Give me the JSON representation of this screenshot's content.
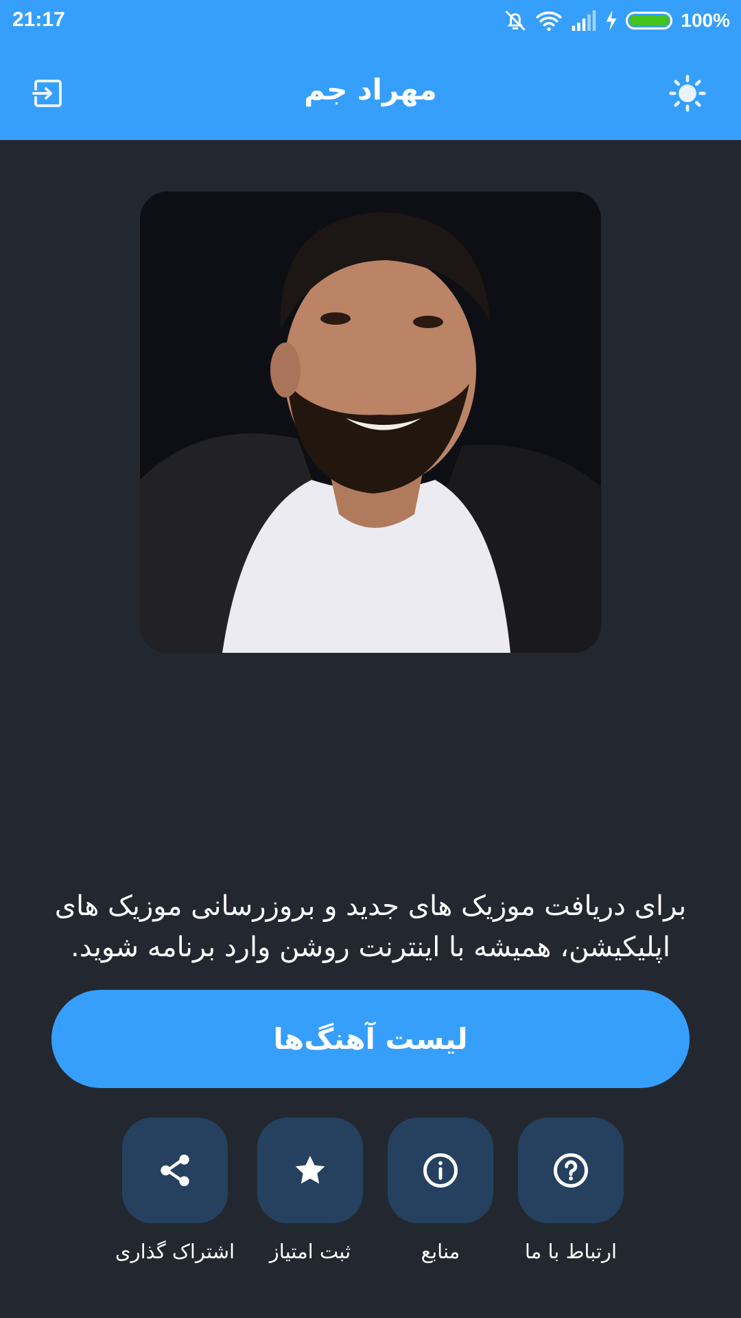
{
  "status_bar": {
    "time": "21:17",
    "battery_percent": "100%",
    "battery_level": 1.0,
    "icons": [
      "muted-bell-icon",
      "wifi-icon",
      "signal-icon",
      "charging-icon",
      "battery-icon"
    ]
  },
  "app_bar": {
    "title": "مهراد جم",
    "left_icon": "exit-icon",
    "right_icon": "brightness-icon"
  },
  "main": {
    "photo_alt": "artist-photo",
    "message": "برای دریافت موزیک های جدید و بروزرسانی موزیک های اپلیکیشن، همیشه با اینترنت روشن وارد برنامه شوید.",
    "primary_button_label": "لیست آهنگ‌ها"
  },
  "actions": [
    {
      "label": "اشتراک گذاری",
      "icon": "share-icon"
    },
    {
      "label": "ثبت امتیاز",
      "icon": "star-icon"
    },
    {
      "label": "منابع",
      "icon": "info-icon"
    },
    {
      "label": "ارتباط با ما",
      "icon": "help-icon"
    }
  ],
  "colors": {
    "primary": "#369ffb",
    "background": "#232830",
    "tile": "#25415f",
    "battery": "#45c21b"
  }
}
